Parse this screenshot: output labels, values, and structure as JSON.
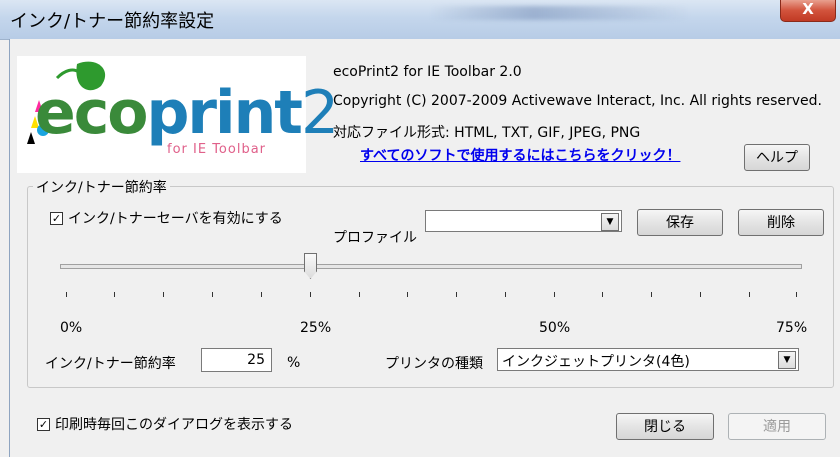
{
  "window": {
    "title": "インク/トナー節約率設定",
    "close_label": "X"
  },
  "logo": {
    "brand_parts": {
      "eco": "eco",
      "print": "print",
      "two": "2"
    },
    "subtitle": "for IE Toolbar"
  },
  "about": {
    "product": "ecoPrint2 for IE Toolbar 2.0",
    "copyright": "Copyright (C) 2007-2009 Activewave Interact, Inc. All rights reserved.",
    "formats": "対応ファイル形式: HTML, TXT, GIF, JPEG, PNG",
    "link_text": "すべてのソフトで使用するにはこちらをクリック！",
    "help_label": "ヘルプ"
  },
  "group": {
    "label": "インク/トナー節約率",
    "enable_saver": {
      "label": "インク/トナーセーバを有効にする",
      "checked": true
    },
    "profile": {
      "label": "プロファイル",
      "value": ""
    },
    "save_label": "保存",
    "delete_label": "削除",
    "slider": {
      "value_percent": 25,
      "tick_labels": [
        "0%",
        "25%",
        "50%",
        "75%"
      ]
    },
    "rate": {
      "label": "インク/トナー節約率",
      "value": "25",
      "unit": "%"
    },
    "printer": {
      "label": "プリンタの種類",
      "value": "インクジェットプリンタ(4色)"
    }
  },
  "footer": {
    "show_dialog": {
      "label": "印刷時毎回このダイアログを表示する",
      "checked": true
    },
    "close_label": "閉じる",
    "apply_label": "適用"
  }
}
